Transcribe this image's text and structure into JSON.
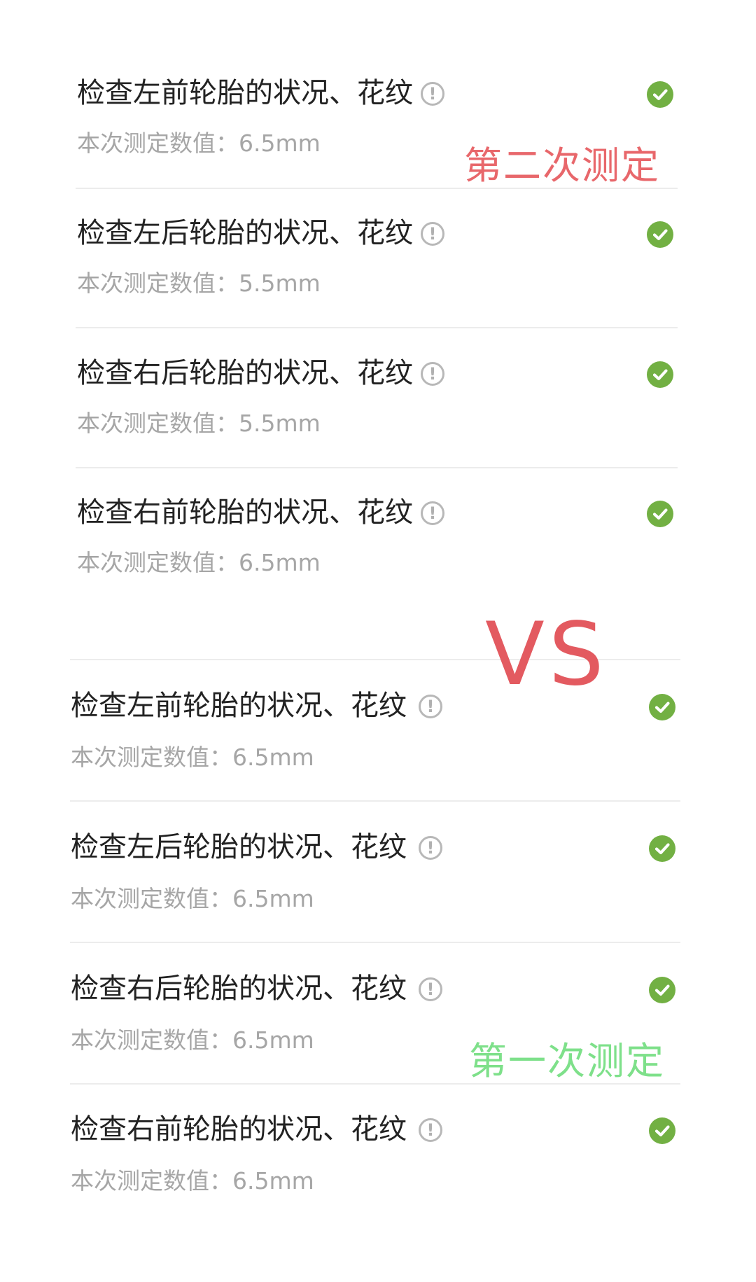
{
  "annotations": {
    "second_measure": "第二次测定",
    "vs": "VS",
    "first_measure": "第一次测定"
  },
  "second_measurement": {
    "items": [
      {
        "title": "检查左前轮胎的状况、花纹",
        "value_text": "本次测定数值：6.5mm",
        "status": "ok"
      },
      {
        "title": "检查左后轮胎的状况、花纹",
        "value_text": "本次测定数值：5.5mm",
        "status": "ok"
      },
      {
        "title": "检查右后轮胎的状况、花纹",
        "value_text": "本次测定数值：5.5mm",
        "status": "ok"
      },
      {
        "title": "检查右前轮胎的状况、花纹",
        "value_text": "本次测定数值：6.5mm",
        "status": "ok"
      }
    ]
  },
  "first_measurement": {
    "items": [
      {
        "title": "检查左前轮胎的状况、花纹",
        "value_text": "本次测定数值：6.5mm",
        "status": "ok"
      },
      {
        "title": "检查左后轮胎的状况、花纹",
        "value_text": "本次测定数值：6.5mm",
        "status": "ok"
      },
      {
        "title": "检查右后轮胎的状况、花纹",
        "value_text": "本次测定数值：6.5mm",
        "status": "ok"
      },
      {
        "title": "检查右前轮胎的状况、花纹",
        "value_text": "本次测定数值：6.5mm",
        "status": "ok"
      }
    ]
  },
  "icons": {
    "info": "info-circle-icon",
    "status_ok": "check-circle-icon"
  },
  "colors": {
    "check_green": "#72b043",
    "second_label": "#e8676b",
    "vs_label": "#e35a60",
    "first_label": "#7ee08a"
  }
}
